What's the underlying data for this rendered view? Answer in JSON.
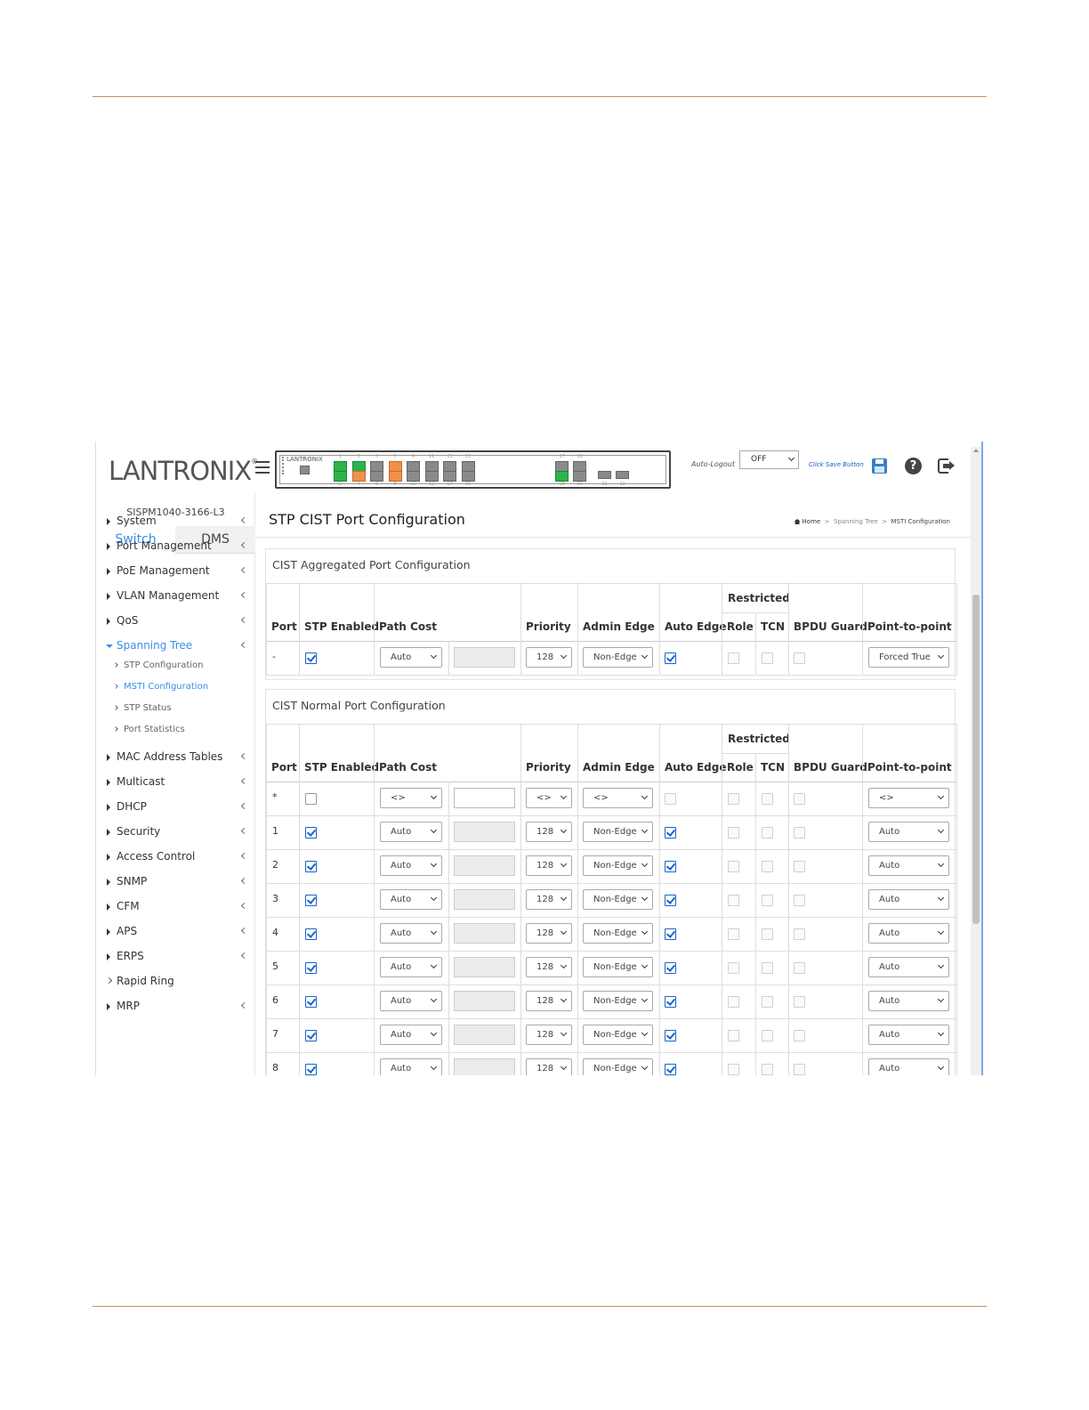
{
  "header": {
    "logo": "LANTRONIX",
    "panel_logo": "LANTRONIX",
    "port_numbers_top": [
      "1",
      "3",
      "5",
      "7",
      "9",
      "11",
      "13",
      "15"
    ],
    "port_numbers_bottom": [
      "2",
      "4",
      "6",
      "8",
      "10",
      "12",
      "14",
      "16"
    ],
    "sfp_numbers_top": [
      "17",
      "19"
    ],
    "sfp_numbers_bottom": [
      "18",
      "20",
      "21",
      "22"
    ],
    "auto_logout_label": "Auto-Logout",
    "auto_logout_value": "OFF",
    "save_label": "Click Save Button",
    "colors": {
      "port_up": "#2fb24b",
      "port_poe": "#f0904a",
      "port_down": "#8a8a8a",
      "brand_red": "#e8473b",
      "accent": "#3a8ee6"
    }
  },
  "sidebar": {
    "model": "SISPM1040-3166-L3",
    "tabs": [
      "Switch",
      "DMS"
    ],
    "items": [
      {
        "label": "System"
      },
      {
        "label": "Port Management"
      },
      {
        "label": "PoE Management"
      },
      {
        "label": "VLAN Management"
      },
      {
        "label": "QoS"
      },
      {
        "label": "Spanning Tree"
      },
      {
        "label": "MAC Address Tables"
      },
      {
        "label": "Multicast"
      },
      {
        "label": "DHCP"
      },
      {
        "label": "Security"
      },
      {
        "label": "Access Control"
      },
      {
        "label": "SNMP"
      },
      {
        "label": "CFM"
      },
      {
        "label": "APS"
      },
      {
        "label": "ERPS"
      },
      {
        "label": "Rapid Ring"
      },
      {
        "label": "MRP"
      }
    ],
    "spanning_tree_sub": [
      "STP Configuration",
      "MSTI Configuration",
      "STP Status",
      "Port Statistics"
    ]
  },
  "main": {
    "title": "STP CIST Port Configuration",
    "breadcrumb": {
      "home": "Home",
      "sep": ">",
      "middle": "Spanning Tree",
      "current": "MSTI Configuration"
    },
    "columns": {
      "port": "Port",
      "stp_enabled": "STP Enabled",
      "path_cost": "Path Cost",
      "priority": "Priority",
      "admin_edge": "Admin Edge",
      "auto_edge": "Auto Edge",
      "restricted": "Restricted",
      "role": "Role",
      "tcn": "TCN",
      "bpdu_guard": "BPDU Guard",
      "p2p": "Point-to-point"
    },
    "aggregated": {
      "title": "CIST Aggregated Port Configuration",
      "row": {
        "port": "-",
        "stp": true,
        "path_cost": "Auto",
        "priority": "128",
        "admin_edge": "Non-Edge",
        "auto_edge": true,
        "p2p": "Forced True"
      }
    },
    "normal": {
      "title": "CIST Normal Port Configuration",
      "wildcard": {
        "port": "*",
        "path_cost": "<>",
        "priority": "<>",
        "admin_edge": "<>",
        "p2p": "<>"
      },
      "rows": [
        {
          "port": "1",
          "path_cost": "Auto",
          "priority": "128",
          "admin_edge": "Non-Edge",
          "p2p": "Auto"
        },
        {
          "port": "2",
          "path_cost": "Auto",
          "priority": "128",
          "admin_edge": "Non-Edge",
          "p2p": "Auto"
        },
        {
          "port": "3",
          "path_cost": "Auto",
          "priority": "128",
          "admin_edge": "Non-Edge",
          "p2p": "Auto"
        },
        {
          "port": "4",
          "path_cost": "Auto",
          "priority": "128",
          "admin_edge": "Non-Edge",
          "p2p": "Auto"
        },
        {
          "port": "5",
          "path_cost": "Auto",
          "priority": "128",
          "admin_edge": "Non-Edge",
          "p2p": "Auto"
        },
        {
          "port": "6",
          "path_cost": "Auto",
          "priority": "128",
          "admin_edge": "Non-Edge",
          "p2p": "Auto"
        },
        {
          "port": "7",
          "path_cost": "Auto",
          "priority": "128",
          "admin_edge": "Non-Edge",
          "p2p": "Auto"
        },
        {
          "port": "8",
          "path_cost": "Auto",
          "priority": "128",
          "admin_edge": "Non-Edge",
          "p2p": "Auto"
        }
      ]
    }
  }
}
